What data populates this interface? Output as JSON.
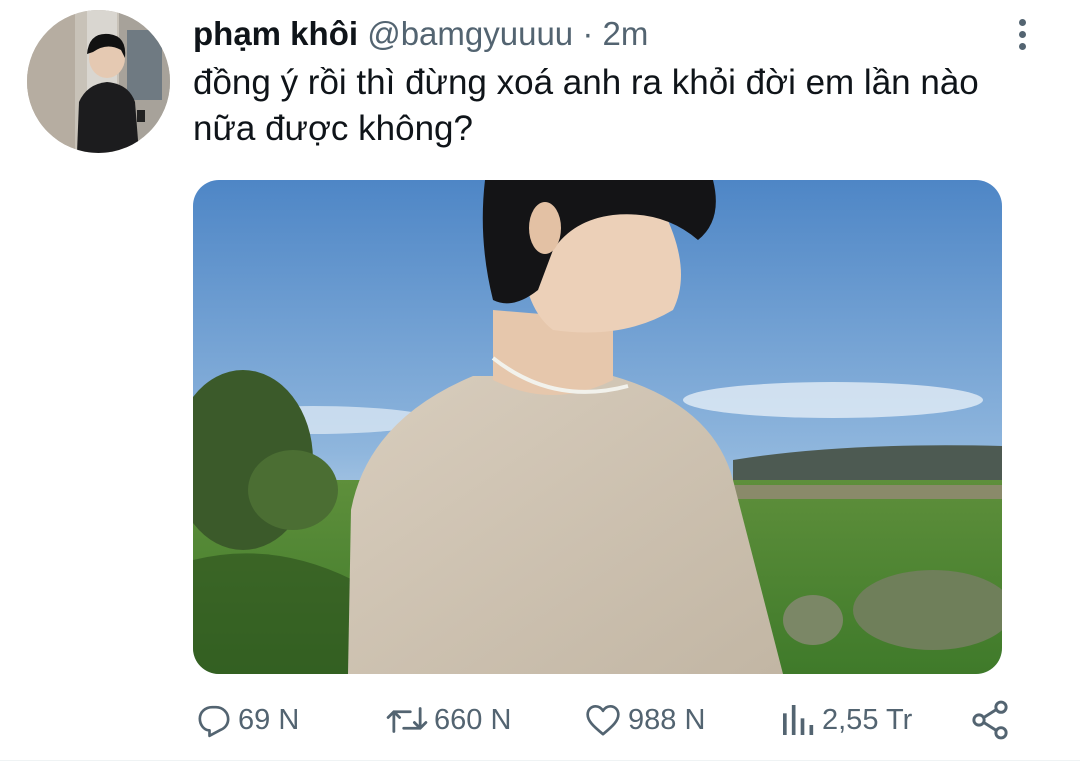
{
  "tweet": {
    "display_name": "phạm khôi",
    "handle": "@bamgyuuuu",
    "separator": "·",
    "time": "2m",
    "text": "đồng ý rồi thì đừng xoá anh ra khỏi đời em lần nào nữa được không?"
  },
  "actions": {
    "reply_count": "69 N",
    "retweet_count": "660 N",
    "like_count": "988 N",
    "views_count": "2,55 Tr"
  },
  "icons": {
    "more": "more-vertical-icon",
    "reply": "reply-icon",
    "retweet": "retweet-icon",
    "like": "heart-icon",
    "views": "analytics-icon",
    "share": "share-icon"
  },
  "colors": {
    "text_primary": "#0f1419",
    "text_secondary": "#536471"
  }
}
